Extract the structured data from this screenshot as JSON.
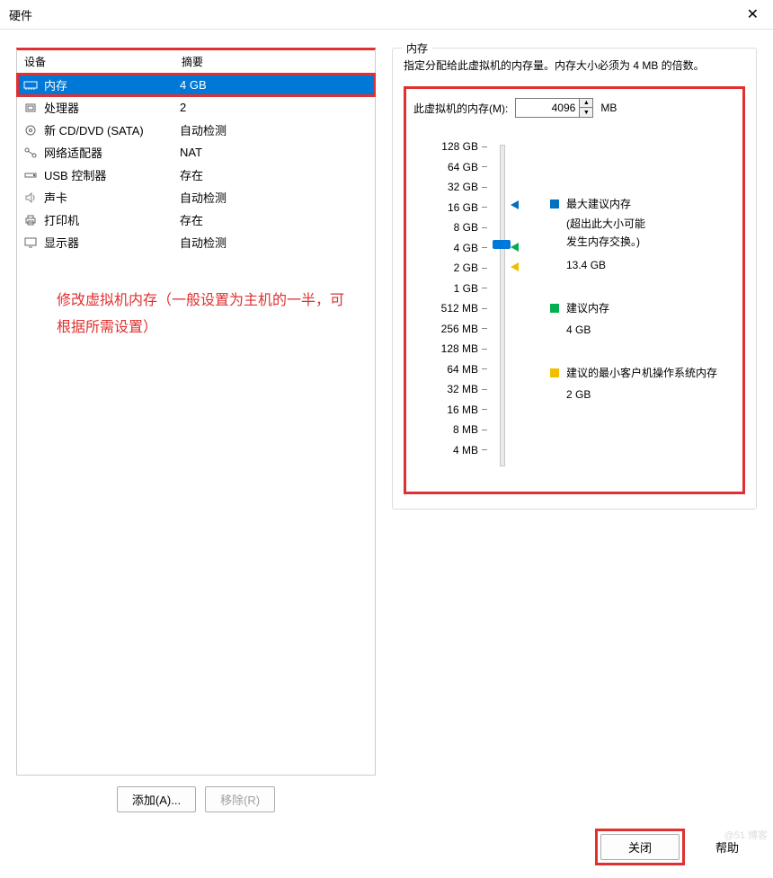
{
  "title": "硬件",
  "columns": {
    "device": "设备",
    "summary": "摘要"
  },
  "devices": [
    {
      "name": "内存",
      "summary": "4 GB",
      "icon": "memory",
      "selected": true
    },
    {
      "name": "处理器",
      "summary": "2",
      "icon": "cpu"
    },
    {
      "name": "新 CD/DVD (SATA)",
      "summary": "自动检测",
      "icon": "disc"
    },
    {
      "name": "网络适配器",
      "summary": "NAT",
      "icon": "network"
    },
    {
      "name": "USB 控制器",
      "summary": "存在",
      "icon": "usb"
    },
    {
      "name": "声卡",
      "summary": "自动检测",
      "icon": "sound"
    },
    {
      "name": "打印机",
      "summary": "存在",
      "icon": "printer"
    },
    {
      "name": "显示器",
      "summary": "自动检测",
      "icon": "display"
    }
  ],
  "annotation": "修改虚拟机内存（一般设置为主机的一半，可根据所需设置）",
  "buttons": {
    "add": "添加(A)...",
    "remove": "移除(R)",
    "close": "关闭",
    "help": "帮助"
  },
  "memory": {
    "group_title": "内存",
    "desc": "指定分配给此虚拟机的内存量。内存大小必须为 4 MB 的倍数。",
    "label": "此虚拟机的内存(M):",
    "value": "4096",
    "unit": "MB"
  },
  "scale": [
    "128 GB",
    "64 GB",
    "32 GB",
    "16 GB",
    "8 GB",
    "4 GB",
    "2 GB",
    "1 GB",
    "512 MB",
    "256 MB",
    "128 MB",
    "64 MB",
    "32 MB",
    "16 MB",
    "8 MB",
    "4 MB"
  ],
  "legend": {
    "max_title": "最大建议内存",
    "max_note1": "(超出此大小可能",
    "max_note2": "发生内存交换。)",
    "max_value": "13.4 GB",
    "rec_title": "建议内存",
    "rec_value": "4 GB",
    "min_title": "建议的最小客户机操作系统内存",
    "min_value": "2 GB"
  },
  "watermark": "@51  博客"
}
